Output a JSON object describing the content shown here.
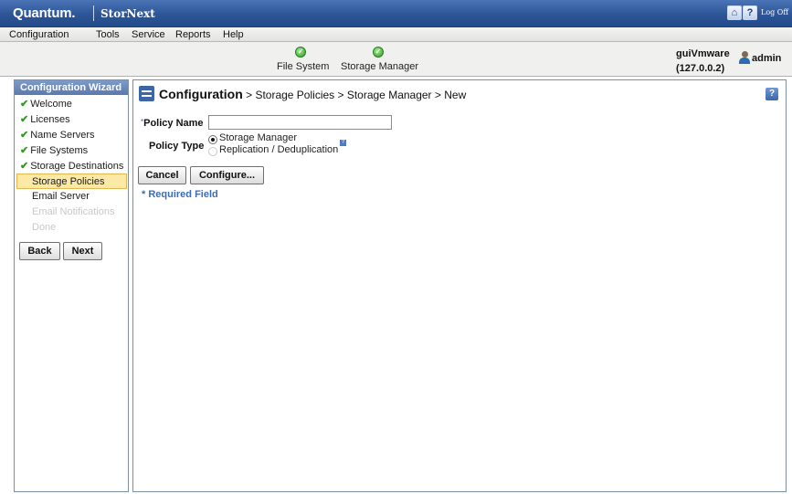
{
  "header": {
    "brand": "Quantum.",
    "product": "StorNext",
    "logoff_label": "Log Off"
  },
  "menu": {
    "items": [
      "Configuration",
      "Tools",
      "Service",
      "Reports",
      "Help"
    ]
  },
  "status": {
    "items": [
      {
        "label": "File System",
        "state": "ok"
      },
      {
        "label": "Storage Manager",
        "state": "ok"
      }
    ],
    "host_name": "guiVmware",
    "host_ip": "(127.0.0.2)",
    "user": "admin"
  },
  "wizard": {
    "title": "Configuration Wizard",
    "items": [
      {
        "label": "Welcome",
        "state": "done"
      },
      {
        "label": "Licenses",
        "state": "done"
      },
      {
        "label": "Name Servers",
        "state": "done"
      },
      {
        "label": "File Systems",
        "state": "done"
      },
      {
        "label": "Storage Destinations",
        "state": "done"
      },
      {
        "label": "Storage Policies",
        "state": "active"
      },
      {
        "label": "Email Server",
        "state": "pending"
      },
      {
        "label": "Email Notifications",
        "state": "disabled"
      },
      {
        "label": "Done",
        "state": "disabled"
      }
    ],
    "back_label": "Back",
    "next_label": "Next"
  },
  "main": {
    "breadcrumb_title": "Configuration",
    "breadcrumb_path": " > Storage Policies > Storage Manager > New",
    "form": {
      "required_mark": "*",
      "policy_name_label": "Policy Name",
      "policy_name_value": "",
      "policy_type_label": "Policy Type",
      "policy_type_options": [
        {
          "label": "Storage Manager",
          "selected": true,
          "enabled": true
        },
        {
          "label": "Replication / Deduplication",
          "selected": false,
          "enabled": false
        }
      ]
    },
    "cancel_label": "Cancel",
    "configure_label": "Configure...",
    "required_note": "* Required Field"
  },
  "colors": {
    "header_blue": "#2c5597",
    "accent_blue": "#3b6cb4",
    "active_highlight": "#fde9a6",
    "check_green": "#2e9d1e"
  }
}
